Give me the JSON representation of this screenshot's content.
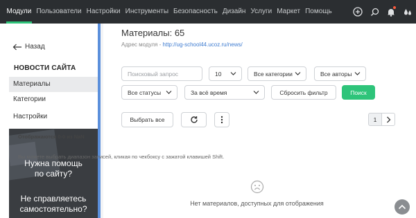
{
  "nav": {
    "items": [
      {
        "label": "Модули",
        "active": true
      },
      {
        "label": "Пользователи"
      },
      {
        "label": "Настройки"
      },
      {
        "label": "Инструменты"
      },
      {
        "label": "Безопасность"
      },
      {
        "label": "Дизайн"
      },
      {
        "label": "Услуги"
      },
      {
        "label": "Маркет"
      },
      {
        "label": "Помощь"
      }
    ],
    "icons": [
      "add-circle-icon",
      "search-icon",
      "bell-icon",
      "drops-icon"
    ]
  },
  "sidebar": {
    "back_label": "Назад",
    "section_title": "НОВОСТИ САЙТА",
    "items": [
      {
        "label": "Материалы",
        "active": true
      },
      {
        "label": "Категории"
      },
      {
        "label": "Настройки"
      }
    ],
    "help": {
      "line1": "Нужна помощь",
      "line2": "по сайту?",
      "line3": "Не справляетесь",
      "line4": "самостоятельно?"
    }
  },
  "main": {
    "title": "Материалы: 65",
    "address_label": "Адрес модуля -",
    "address_url": "http://ug-school44.ucoz.ru/news/",
    "filters": {
      "search_placeholder": "Поисковый запрос",
      "per_page": "10",
      "category": "Все категории",
      "author": "Все авторы",
      "status": "Все статусы",
      "period": "За всё время",
      "reset_label": "Сбросить фильтр",
      "search_label": "Поиск"
    },
    "actions": {
      "select_all": "Выбрать все"
    },
    "pager": {
      "current": "1"
    },
    "shown_text": "Отображаются 0-0 из NaN",
    "hint_text": "Вы можете выбрать диапазон записей, кликая по чекбоксу с зажатой клавишей Shift.",
    "empty_text": "Нет материалов, доступных для отображения"
  },
  "colors": {
    "accent": "#2ec47a",
    "topbar": "#2b2e31",
    "link": "#3d7bd0",
    "sidebar_border": "#5b8fdb"
  }
}
